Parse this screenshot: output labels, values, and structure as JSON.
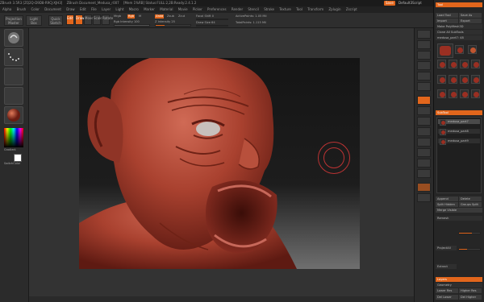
{
  "titlebar": {
    "items": [
      "ZBrush 3.5R3 [ZQ2Q-D9D8-R9CJ-XJH3]",
      "ZBrush Document_Medusa_r007",
      "[Mem 1%RB] Status:FULL:2,2B:Ready:2.4.1.2"
    ],
    "quick": "Default3Script",
    "save": "Save"
  },
  "menubar": [
    "Alpha",
    "Brush",
    "Color",
    "Document",
    "Draw",
    "Edit",
    "File",
    "Layer",
    "Light",
    "Macro",
    "Marker",
    "Material",
    "Movie",
    "Picker",
    "Preferences",
    "Render",
    "Stencil",
    "Stroke",
    "Texture",
    "Tool",
    "Transform",
    "Zplugin",
    "Zscript"
  ],
  "toolbar": {
    "projection_master": "Projection Master",
    "lightbox": "Light Box",
    "quick_sketch": "Quick Sketch",
    "edit": "Edit",
    "draw": "Draw",
    "move": "Move",
    "scale": "Scale",
    "rotate": "Rotate",
    "mrgb": "Mrgb",
    "rgb": "Rgb",
    "m": "M",
    "rgb_intensity": "Rgb Intensity 100",
    "zadd": "Zadd",
    "zsub": "Zsub",
    "zcut": "Zcut",
    "z_intensity": "Z Intensity 25",
    "focal_shift": "Focal Shift 0",
    "draw_size": "Draw Size 64",
    "active_points": "ActivePoints: 1.05 Mil",
    "total_points": "TotalPoints: 1.115 Mil"
  },
  "leftshelf": {
    "gradient_label": "Gradient",
    "switch_color_label": "SwitchColor"
  },
  "tray": {
    "header": "Tool",
    "load_tool": "Load Tool",
    "save_as": "Save As",
    "import": "Import",
    "export": "Export",
    "clone": "Clone",
    "make_polymesh": "Make PolyMesh3D",
    "clone_all": "Clone All SubTools",
    "current_tool": "medusa_part7: 48",
    "subtool_header": "SubTool",
    "subtools": [
      "medusa_part7",
      "medusa_part8",
      "medusa_part9"
    ],
    "append": "Append",
    "delete": "Delete",
    "split_hidden": "Split Hidden",
    "groups_split": "Groups Split",
    "merge_visible": "Merge Visible",
    "remesh": "Remesh",
    "project_all": "ProjectAll",
    "extract": "Extract",
    "layers_header": "Layers",
    "geometry_header": "Geometry",
    "lower_res": "Lower Res",
    "higher_res": "Higher Res",
    "del_lower": "Del Lower",
    "del_higher": "Del Higher"
  },
  "colors": {
    "accent": "#e2661c",
    "clay": "#b04a3a"
  }
}
